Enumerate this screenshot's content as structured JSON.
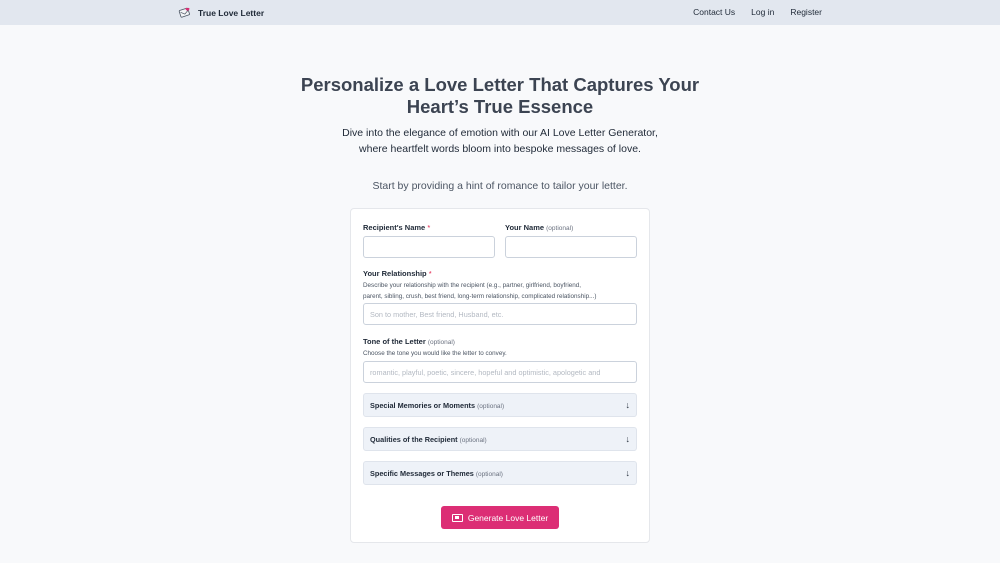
{
  "header": {
    "brand": "True Love Letter",
    "nav": {
      "contact": "Contact Us",
      "login": "Log in",
      "register": "Register"
    }
  },
  "hero": {
    "title_line1": "Personalize a Love Letter That Captures Your",
    "title_line2": "Heart’s True Essence",
    "subtitle_line1": "Dive into the elegance of emotion with our AI Love Letter Generator,",
    "subtitle_line2": "where heartfelt words bloom into bespoke messages of love.",
    "hint": "Start by providing a hint of romance to tailor your letter."
  },
  "form": {
    "recipient": {
      "label": "Recipient's Name",
      "required_mark": "*",
      "value": ""
    },
    "your_name": {
      "label": "Your Name",
      "optional": "(optional)",
      "value": ""
    },
    "relationship": {
      "label": "Your Relationship",
      "required_mark": "*",
      "help_line1": "Describe your relationship with the recipient (e.g., partner, girlfriend, boyfriend,",
      "help_line2": "parent, sibling, crush, best friend, long-term relationship, complicated relationship...)",
      "placeholder": "Son to mother, Best friend, Husband, etc."
    },
    "tone": {
      "label": "Tone of the Letter",
      "optional": "(optional)",
      "help": "Choose the tone you would like the letter to convey.",
      "placeholder": "romantic, playful, poetic, sincere, hopeful and optimistic, apologetic and"
    },
    "sections": [
      {
        "label": "Special Memories or Moments",
        "optional": "(optional)"
      },
      {
        "label": "Qualities of the Recipient",
        "optional": "(optional)"
      },
      {
        "label": "Specific Messages or Themes",
        "optional": "(optional)"
      }
    ],
    "submit": "Generate Love Letter"
  },
  "colors": {
    "accent": "#dc2e75",
    "header_bg": "#e2e7ef",
    "required": "#e11d48"
  },
  "icons": {
    "brand": "love-letter-logo-icon",
    "accordion": "arrow-down-icon",
    "submit": "envelope-icon"
  }
}
